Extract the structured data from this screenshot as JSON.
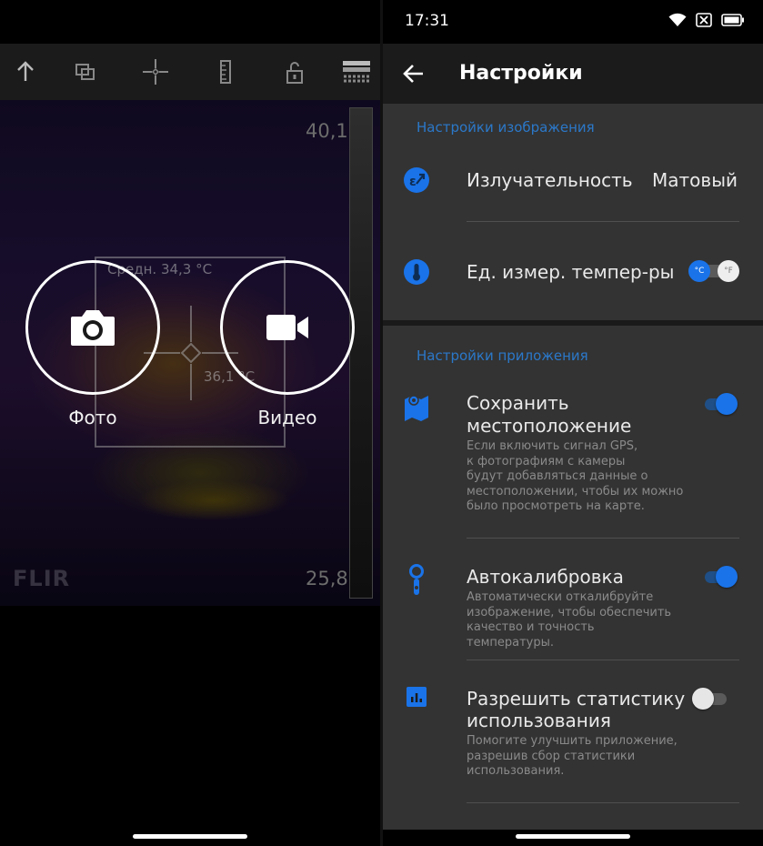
{
  "camera": {
    "scale_max": "40,1",
    "scale_min": "25,8",
    "measure_avg": "Средн. 34,3 °C",
    "measure_spot": "36,1 °C",
    "logo": "FLIR",
    "photo_label": "Фото",
    "video_label": "Видео",
    "toolbar_icons": [
      "arrow-up-icon",
      "overlay-icon",
      "crosshair-icon",
      "ruler-icon",
      "unlock-icon",
      "palette-icon"
    ]
  },
  "status": {
    "time": "17:31",
    "icons": [
      "wifi-icon",
      "no-sim-icon",
      "battery-icon"
    ]
  },
  "settings": {
    "title": "Настройки",
    "image_section": {
      "title": "Настройки изображения",
      "emissivity": {
        "label": "Излучательность",
        "value": "Матовый",
        "icon": "emissivity-icon"
      },
      "temp_unit": {
        "label": "Ед. измер. темпер-ры",
        "celsius": "°C",
        "fahrenheit": "°F",
        "selected": "°C",
        "icon": "thermometer-icon"
      }
    },
    "app_section": {
      "title": "Настройки приложения",
      "save_location": {
        "title_line1": "Сохранить",
        "title_line2": "местоположение",
        "desc": [
          "Если включить сигнал GPS,",
          "к фотографиям с камеры",
          "будут добавляться данные о",
          "местоположении, чтобы их можно",
          "было просмотреть на карте."
        ],
        "enabled": true,
        "icon": "map-pin-icon"
      },
      "autocalibration": {
        "title": "Автокалибровка",
        "desc": [
          "Автоматически откалибруйте",
          "изображение, чтобы обеспечить",
          "качество и точность температуры."
        ],
        "enabled": true,
        "icon": "calibration-icon"
      },
      "usage_stats": {
        "title_line1": "Разрешить статистику",
        "title_line2": "использования",
        "desc": [
          "Помогите улучшить приложение,",
          "разрешив сбор статистики",
          "использования."
        ],
        "enabled": false,
        "icon": "statistics-icon"
      }
    }
  },
  "colors": {
    "accent": "#1a73e8",
    "section_title": "#2b78c9",
    "panel_bg": "#333333",
    "appbar_bg": "#1b1b1b"
  }
}
